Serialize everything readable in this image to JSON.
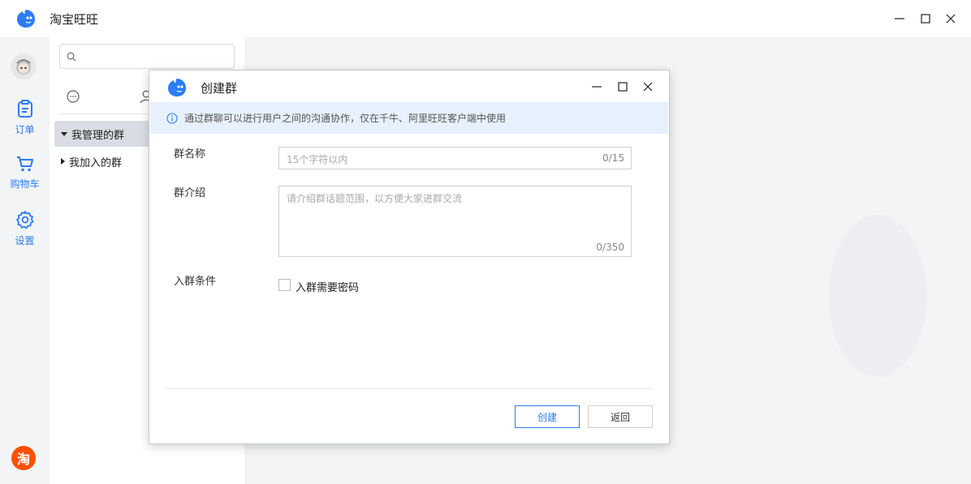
{
  "app": {
    "title": "淘宝旺旺",
    "brand_color": "#2b7cf6"
  },
  "leftnav": {
    "items": [
      {
        "label": "订单",
        "icon": "clipboard-icon"
      },
      {
        "label": "购物车",
        "icon": "cart-icon"
      },
      {
        "label": "设置",
        "icon": "gear-icon"
      }
    ],
    "taobao_label": "淘"
  },
  "midpanel": {
    "search_placeholder": "",
    "groups": [
      {
        "label": "我管理的群",
        "expanded": true,
        "selected": true
      },
      {
        "label": "我加入的群",
        "expanded": false,
        "selected": false
      }
    ]
  },
  "dialog": {
    "title": "创建群",
    "notice": "通过群聊可以进行用户之间的沟通协作，仅在千牛、阿里旺旺客户端中使用",
    "name_label": "群名称",
    "name_placeholder": "15个字符以内",
    "name_count": "0/15",
    "intro_label": "群介绍",
    "intro_placeholder": "请介绍群话题范围，以方便大家进群交流",
    "intro_count": "0/350",
    "condition_label": "入群条件",
    "password_checkbox_label": "入群需要密码",
    "password_required": false,
    "create_label": "创建",
    "back_label": "返回"
  }
}
